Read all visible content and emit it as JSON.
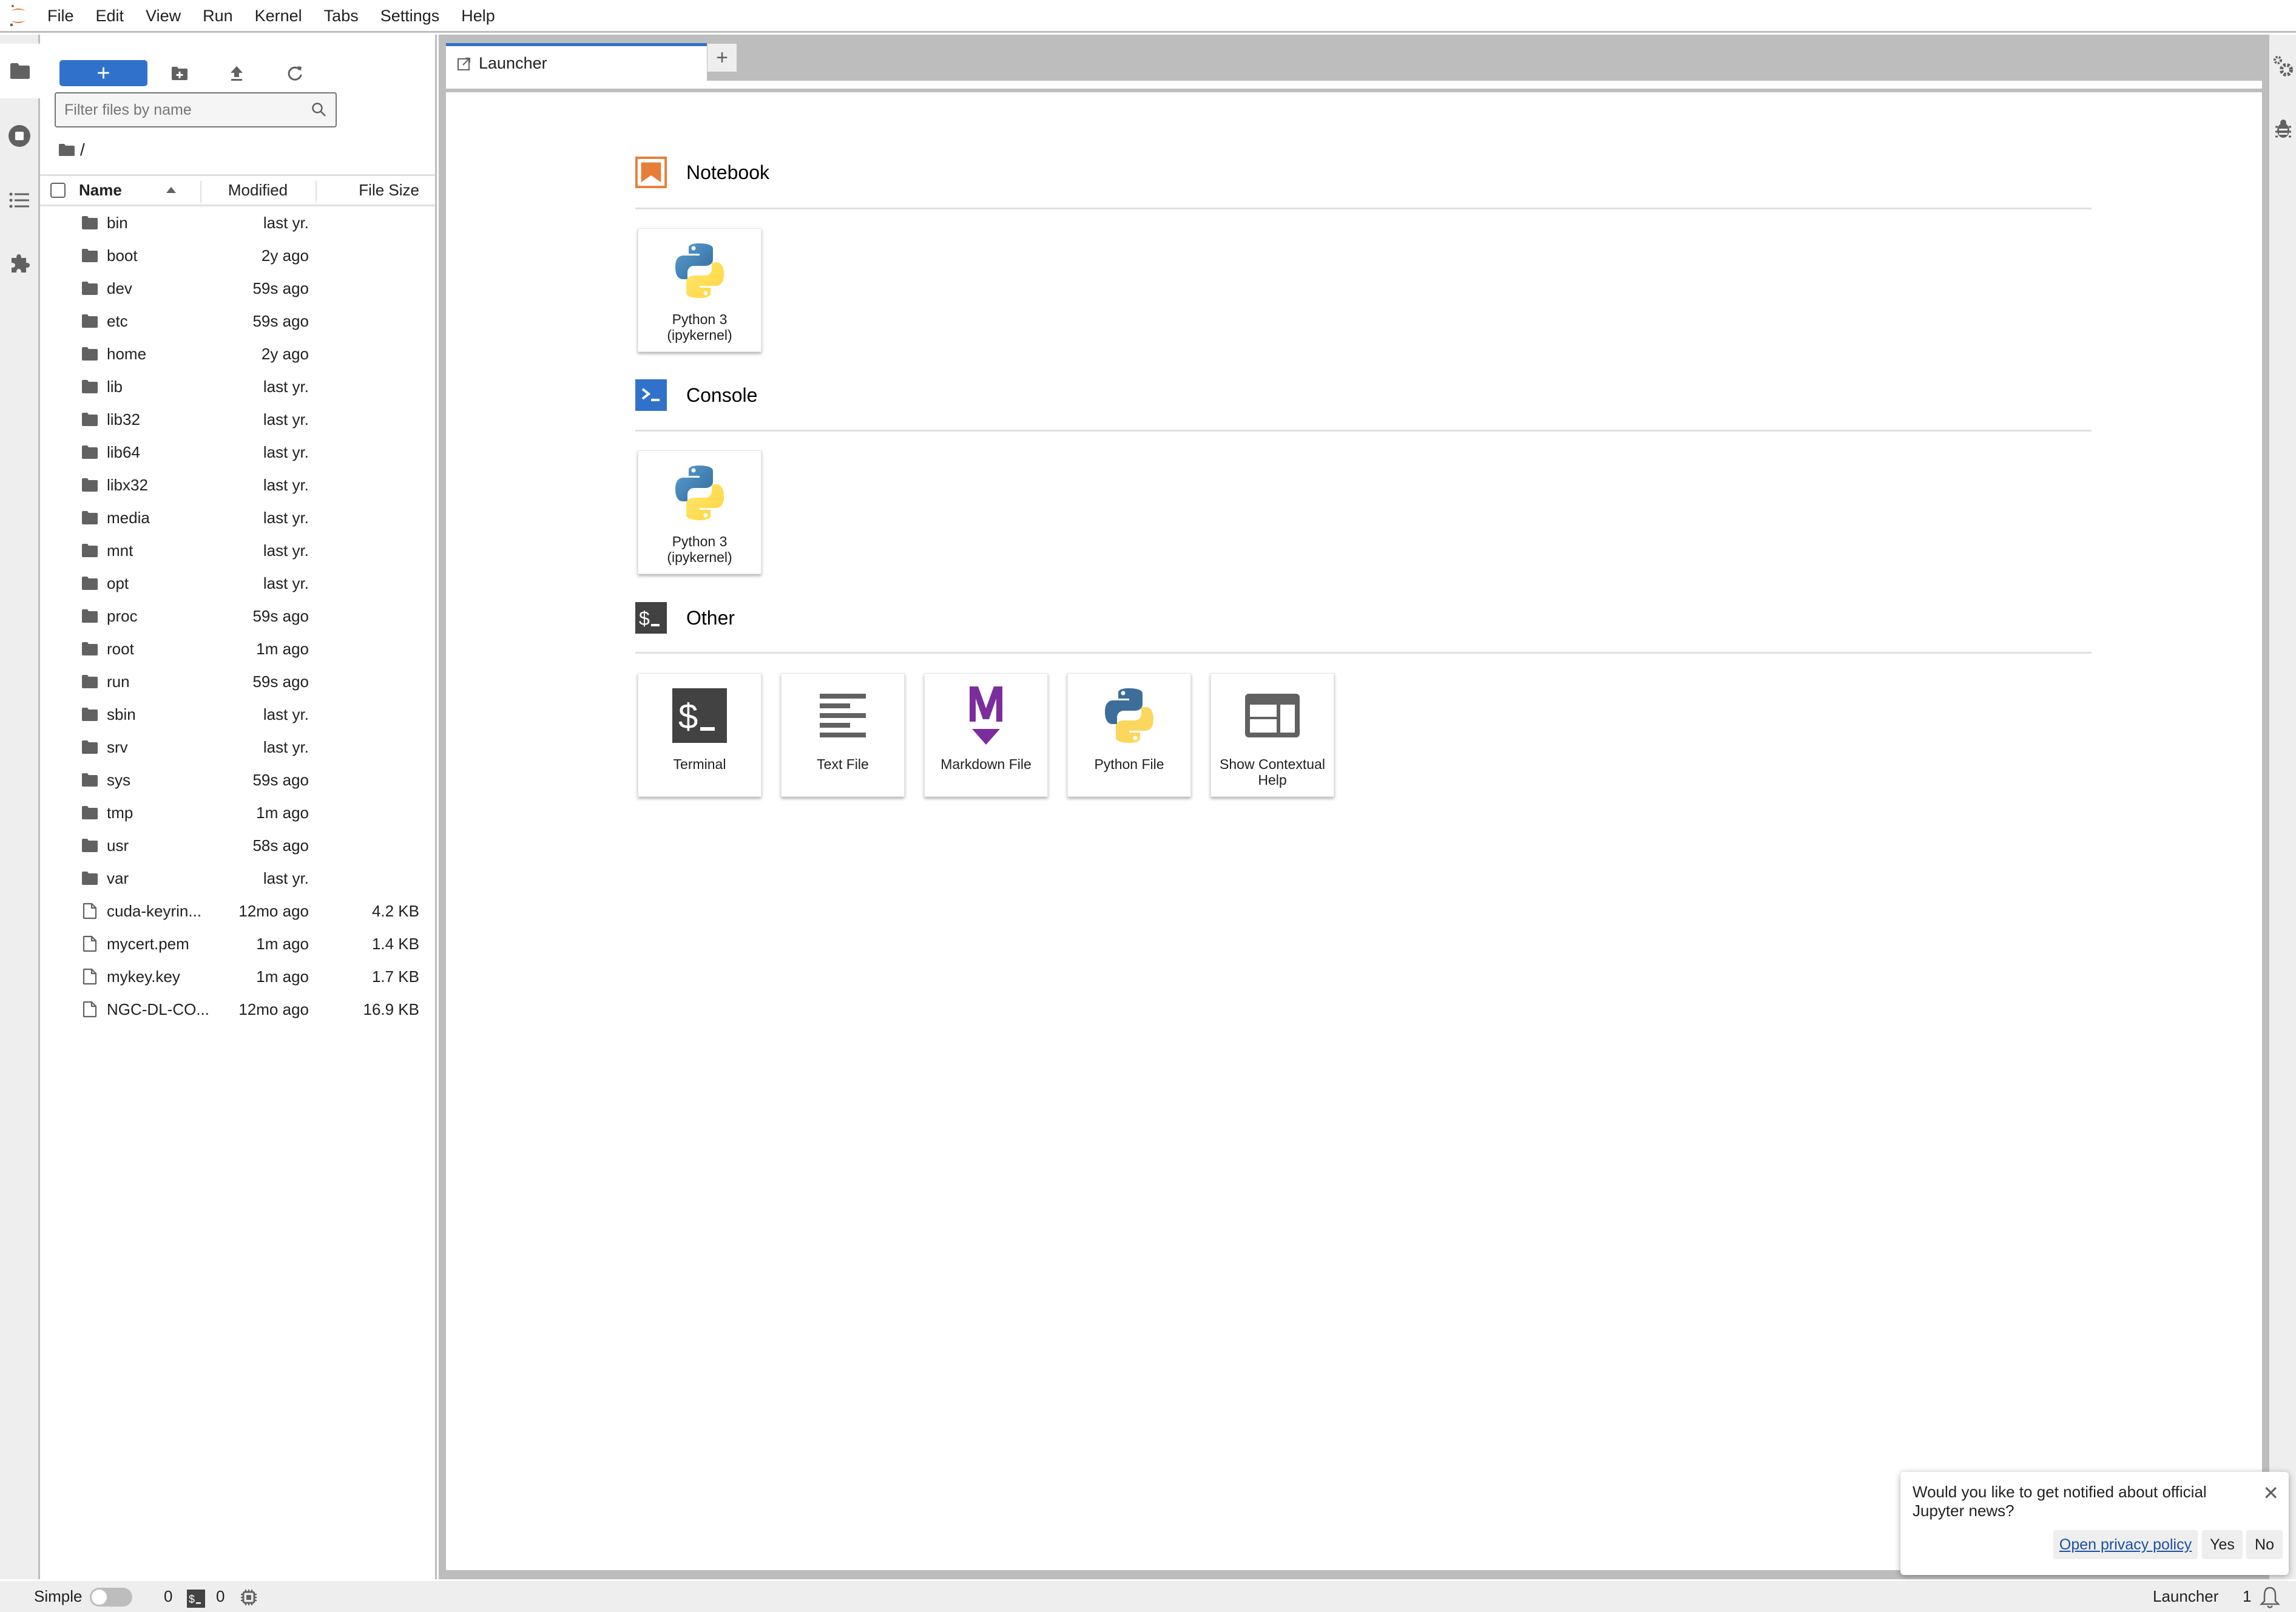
{
  "menubar": {
    "items": [
      "File",
      "Edit",
      "View",
      "Run",
      "Kernel",
      "Tabs",
      "Settings",
      "Help"
    ]
  },
  "activity_bar": {
    "items": [
      {
        "name": "file-browser",
        "icon": "folder-icon"
      },
      {
        "name": "running-kernels",
        "icon": "stop-circle-icon"
      },
      {
        "name": "table-of-contents",
        "icon": "list-icon"
      },
      {
        "name": "extensions",
        "icon": "puzzle-icon"
      }
    ]
  },
  "filebrowser": {
    "new_button_label": "+",
    "filter_placeholder": "Filter files by name",
    "breadcrumb": "/",
    "columns": {
      "name": "Name",
      "modified": "Modified",
      "size": "File Size"
    },
    "files": [
      {
        "type": "folder",
        "name": "bin",
        "modified": "last yr.",
        "size": ""
      },
      {
        "type": "folder",
        "name": "boot",
        "modified": "2y ago",
        "size": ""
      },
      {
        "type": "folder",
        "name": "dev",
        "modified": "59s ago",
        "size": ""
      },
      {
        "type": "folder",
        "name": "etc",
        "modified": "59s ago",
        "size": ""
      },
      {
        "type": "folder",
        "name": "home",
        "modified": "2y ago",
        "size": ""
      },
      {
        "type": "folder",
        "name": "lib",
        "modified": "last yr.",
        "size": ""
      },
      {
        "type": "folder",
        "name": "lib32",
        "modified": "last yr.",
        "size": ""
      },
      {
        "type": "folder",
        "name": "lib64",
        "modified": "last yr.",
        "size": ""
      },
      {
        "type": "folder",
        "name": "libx32",
        "modified": "last yr.",
        "size": ""
      },
      {
        "type": "folder",
        "name": "media",
        "modified": "last yr.",
        "size": ""
      },
      {
        "type": "folder",
        "name": "mnt",
        "modified": "last yr.",
        "size": ""
      },
      {
        "type": "folder",
        "name": "opt",
        "modified": "last yr.",
        "size": ""
      },
      {
        "type": "folder",
        "name": "proc",
        "modified": "59s ago",
        "size": ""
      },
      {
        "type": "folder",
        "name": "root",
        "modified": "1m ago",
        "size": ""
      },
      {
        "type": "folder",
        "name": "run",
        "modified": "59s ago",
        "size": ""
      },
      {
        "type": "folder",
        "name": "sbin",
        "modified": "last yr.",
        "size": ""
      },
      {
        "type": "folder",
        "name": "srv",
        "modified": "last yr.",
        "size": ""
      },
      {
        "type": "folder",
        "name": "sys",
        "modified": "59s ago",
        "size": ""
      },
      {
        "type": "folder",
        "name": "tmp",
        "modified": "1m ago",
        "size": ""
      },
      {
        "type": "folder",
        "name": "usr",
        "modified": "58s ago",
        "size": ""
      },
      {
        "type": "folder",
        "name": "var",
        "modified": "last yr.",
        "size": ""
      },
      {
        "type": "file",
        "name": "cuda-keyrin...",
        "modified": "12mo ago",
        "size": "4.2 KB"
      },
      {
        "type": "file",
        "name": "mycert.pem",
        "modified": "1m ago",
        "size": "1.4 KB"
      },
      {
        "type": "file",
        "name": "mykey.key",
        "modified": "1m ago",
        "size": "1.7 KB"
      },
      {
        "type": "file",
        "name": "NGC-DL-CO...",
        "modified": "12mo ago",
        "size": "16.9 KB"
      }
    ]
  },
  "tabs": {
    "active": "Launcher",
    "add_label": "+"
  },
  "launcher": {
    "sections": [
      {
        "title": "Notebook",
        "icon": "notebook-icon",
        "color": "#e67e37",
        "cards": [
          {
            "label": "Python 3 (ipykernel)",
            "icon": "python-logo-icon"
          }
        ]
      },
      {
        "title": "Console",
        "icon": "console-icon",
        "color": "#3072cb",
        "cards": [
          {
            "label": "Python 3 (ipykernel)",
            "icon": "python-logo-icon"
          }
        ]
      },
      {
        "title": "Other",
        "icon": "terminal-icon",
        "color": "#424242",
        "cards": [
          {
            "label": "Terminal",
            "icon": "terminal-icon"
          },
          {
            "label": "Text File",
            "icon": "text-file-icon"
          },
          {
            "label": "Markdown File",
            "icon": "markdown-icon"
          },
          {
            "label": "Python File",
            "icon": "python-logo-icon"
          },
          {
            "label": "Show Contextual Help",
            "icon": "contextual-help-icon"
          }
        ]
      }
    ]
  },
  "right_bar": {
    "items": [
      {
        "name": "property-inspector",
        "icon": "gears-icon"
      },
      {
        "name": "debugger",
        "icon": "bug-icon"
      }
    ]
  },
  "statusbar": {
    "mode_label": "Simple",
    "simple_mode_on": false,
    "kernels_count": "0",
    "terminals_count": "0",
    "current_activity": "Launcher",
    "notifications_count": "1"
  },
  "notification": {
    "message": "Would you like to get notified about official Jupyter news?",
    "privacy_link": "Open privacy policy",
    "yes_label": "Yes",
    "no_label": "No"
  }
}
